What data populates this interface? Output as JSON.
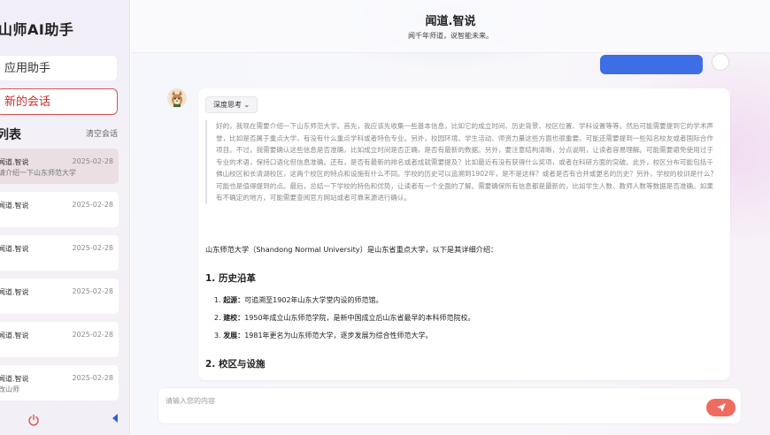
{
  "sidebar": {
    "app_title": "山师AI助手",
    "apps_label": "应用助手",
    "new_chat_label": "新的会话",
    "list_title": "列表",
    "clear_label": "清空会话",
    "conversations": [
      {
        "title": "闻道.智说",
        "date": "2025-02-28",
        "subtitle": "请介绍一下山东师范大学"
      },
      {
        "title": "闻道.智说",
        "date": "2025-02-28",
        "subtitle": ""
      },
      {
        "title": "闻道.智说",
        "date": "2025-02-28",
        "subtitle": ""
      },
      {
        "title": "闻道.智说",
        "date": "2025-02-28",
        "subtitle": ""
      },
      {
        "title": "闻道.智说",
        "date": "2025-02-28",
        "subtitle": ""
      },
      {
        "title": "闻道.智说",
        "date": "2025-02-28",
        "subtitle": "改山师"
      }
    ]
  },
  "header": {
    "title": "闻道.智说",
    "subtitle": "闻千年师道，说智能未来。"
  },
  "answer": {
    "think_button": "深度思考 ⌄",
    "thinking": "好的，我现在需要介绍一下山东师范大学。首先，我应该先收集一些基本信息，比如它的成立时间、历史背景、校区位置、学科设置等等。然后可能需要提到它的学术声誉，比如是否属于重点大学，有没有什么重点学科或者特色专业。另外，校园环境、学生活动、师资力量这些方面也很重要。可能还需要提到一些知名校友或者国际合作项目。不过，我需要确认这些信息是否准确，比如成立时间是否正确，是否有最新的数据。另外，要注意结构清晰，分点说明，让读者容易理解。可能需要避免使用过于专业的术语，保持口语化但信息准确。还有，是否有最新的排名或者成就需要提及？比如最近有没有获得什么奖项，或者在科研方面的突破。此外，校区分布可能包括千佛山校区和长清湖校区，这两个校区的特点和设施有什么不同。学校的历史可以追溯到1902年，是不是这样？或者是否有合并或更名的历史？另外，学校的校训是什么？可能也是值得提到的点。最后，总结一下学校的特色和优势，让读者有一个全面的了解。需要确保所有信息都是最新的，比如学生人数、教师人数等数据是否准确。如果有不确定的地方，可能需要查阅官方网站或者可靠来源进行确认。",
    "intro": "山东师范大学（Shandong Normal University）是山东省重点大学，以下是其详细介绍：",
    "section1_title": "1. 历史沿革",
    "history": [
      {
        "num": "1.",
        "label": "起源：",
        "text": "可追溯至1902年山东大学堂内设的师范馆。"
      },
      {
        "num": "2.",
        "label": "建校：",
        "text": "1950年成立山东师范学院，是新中国成立后山东省最早的本科师范院校。"
      },
      {
        "num": "3.",
        "label": "发展：",
        "text": "1981年更名为山东师范大学，逐步发展为综合性师范大学。"
      }
    ],
    "section2_title": "2. 校区与设施"
  },
  "input": {
    "placeholder": "请输入您的内容"
  },
  "colors": {
    "accent": "#3d6ee6",
    "new_chat_border": "#d9534f",
    "send_button": "#f16a5f"
  }
}
